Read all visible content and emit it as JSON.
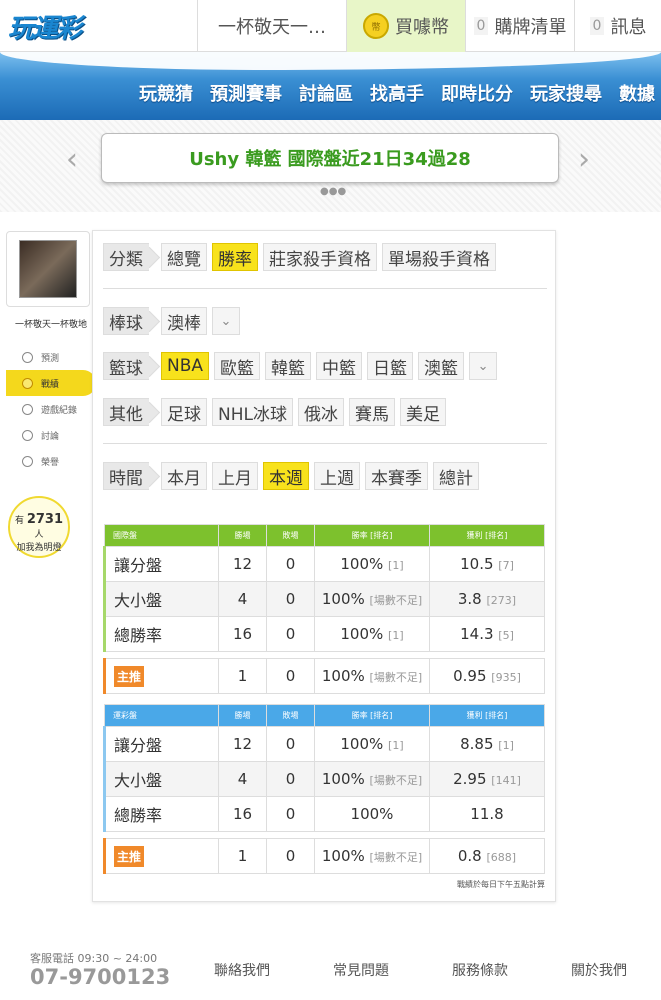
{
  "topbar": {
    "logo": "玩運彩",
    "user_tab": "一杯敬天一…",
    "coin_icon_text": "幣",
    "buy_coin": "買噱幣",
    "cart_count": "0",
    "cart_label": "購牌清單",
    "msg_count": "0",
    "msg_label": "訊息"
  },
  "nav": [
    "玩競猜",
    "預測賽事",
    "討論區",
    "找高手",
    "即時比分",
    "玩家搜尋",
    "數據"
  ],
  "banner": {
    "text": "Ushy 韓籃 國際盤近21日34過28",
    "left_arrow": "‹",
    "right_arrow": "›",
    "dots": "●●●"
  },
  "sidebar": {
    "username": "一杯敬天一杯敬地",
    "items": [
      {
        "label": "預測",
        "icon": "target-icon"
      },
      {
        "label": "戰績",
        "icon": "chat-icon"
      },
      {
        "label": "遊戲紀錄",
        "icon": "record-icon"
      },
      {
        "label": "討論",
        "icon": "discuss-icon"
      },
      {
        "label": "榮譽",
        "icon": "trophy-icon"
      }
    ],
    "fans_prefix": "有",
    "fans_count": "2731",
    "fans_suffix": "人",
    "fans_text": "加我為明燈"
  },
  "filters": {
    "category_head": "分類",
    "category": [
      "總覽",
      "勝率",
      "莊家殺手資格",
      "單場殺手資格"
    ],
    "baseball_head": "棒球",
    "baseball": [
      "澳棒"
    ],
    "basketball_head": "籃球",
    "basketball": [
      "NBA",
      "歐籃",
      "韓籃",
      "中籃",
      "日籃",
      "澳籃"
    ],
    "other_head": "其他",
    "other": [
      "足球",
      "NHL冰球",
      "俄冰",
      "賽馬",
      "美足"
    ],
    "time_head": "時間",
    "time": [
      "本月",
      "上月",
      "本週",
      "上週",
      "本賽季",
      "總計"
    ],
    "dropdown": "⌄"
  },
  "intl_table": {
    "headers": [
      "國際盤",
      "勝場",
      "敗場",
      "勝率 [排名]",
      "獲利 [排名]"
    ],
    "rows": [
      {
        "label": "讓分盤",
        "win": "12",
        "lose": "0",
        "rate": "100%",
        "rate_rank": "[1]",
        "profit": "10.5",
        "profit_rank": "[7]"
      },
      {
        "label": "大小盤",
        "win": "4",
        "lose": "0",
        "rate": "100%",
        "rate_rank": "[場數不足]",
        "profit": "3.8",
        "profit_rank": "[273]"
      },
      {
        "label": "總勝率",
        "win": "16",
        "lose": "0",
        "rate": "100%",
        "rate_rank": "[1]",
        "profit": "14.3",
        "profit_rank": "[5]"
      }
    ],
    "main": {
      "label": "主推",
      "win": "1",
      "lose": "0",
      "rate": "100%",
      "rate_rank": "[場數不足]",
      "profit": "0.95",
      "profit_rank": "[935]"
    }
  },
  "tw_table": {
    "headers": [
      "運彩盤",
      "勝場",
      "敗場",
      "勝率 [排名]",
      "獲利 [排名]"
    ],
    "rows": [
      {
        "label": "讓分盤",
        "win": "12",
        "lose": "0",
        "rate": "100%",
        "rate_rank": "[1]",
        "profit": "8.85",
        "profit_rank": "[1]"
      },
      {
        "label": "大小盤",
        "win": "4",
        "lose": "0",
        "rate": "100%",
        "rate_rank": "[場數不足]",
        "profit": "2.95",
        "profit_rank": "[141]"
      },
      {
        "label": "總勝率",
        "win": "16",
        "lose": "0",
        "rate": "100%",
        "rate_rank": "",
        "profit": "11.8",
        "profit_rank": ""
      }
    ],
    "main": {
      "label": "主推",
      "win": "1",
      "lose": "0",
      "rate": "100%",
      "rate_rank": "[場數不足]",
      "profit": "0.8",
      "profit_rank": "[688]"
    }
  },
  "note": "戰績於每日下午五點計算",
  "footer": {
    "service_label": "客服電話 09:30 ~ 24:00",
    "phone": "07-9700123",
    "links": [
      "聯絡我們",
      "常見問題",
      "服務條款",
      "關於我們"
    ]
  }
}
